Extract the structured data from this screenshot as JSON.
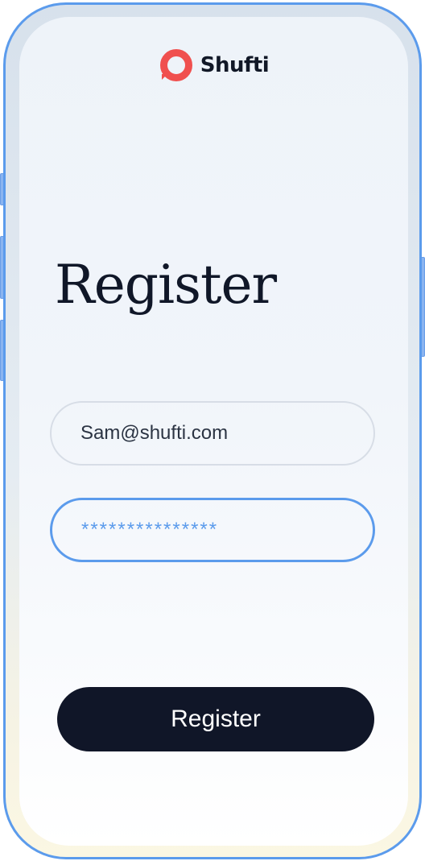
{
  "brand": {
    "name": "Shufti",
    "logo_icon": "shufti-ring-icon",
    "accent_color": "#f0504f"
  },
  "page": {
    "title": "Register"
  },
  "form": {
    "email_value": "Sam@shufti.com",
    "password_value": "***************"
  },
  "actions": {
    "register_label": "Register",
    "button_color": "#101628",
    "focus_color": "#5b9bec"
  }
}
